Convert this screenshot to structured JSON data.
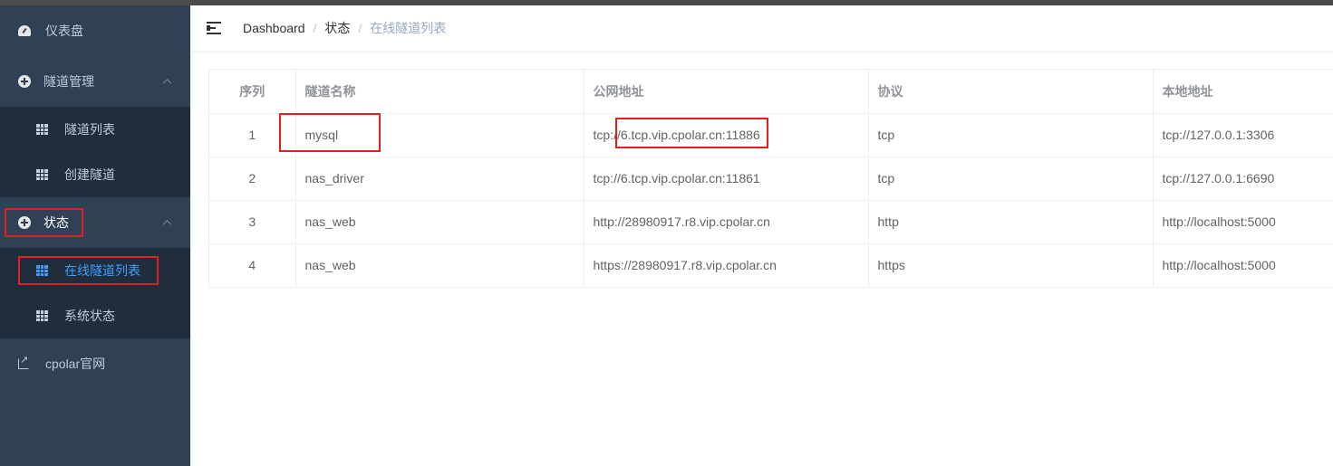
{
  "sidebar": {
    "dashboard": "仪表盘",
    "tunnel_manage": "隧道管理",
    "tunnel_list": "隧道列表",
    "create_tunnel": "创建隧道",
    "status": "状态",
    "online_tunnel_list": "在线隧道列表",
    "system_status": "系统状态",
    "cpolar_site": "cpolar官网"
  },
  "breadcrumb": {
    "root": "Dashboard",
    "sep1": "/",
    "mid": "状态",
    "sep2": "/",
    "current": "在线隧道列表"
  },
  "table": {
    "headers": [
      "序列",
      "隧道名称",
      "公网地址",
      "协议",
      "本地地址"
    ],
    "rows": [
      [
        "1",
        "mysql",
        "tcp://6.tcp.vip.cpolar.cn:11886",
        "tcp",
        "tcp://127.0.0.1:3306"
      ],
      [
        "2",
        "nas_driver",
        "tcp://6.tcp.vip.cpolar.cn:11861",
        "tcp",
        "tcp://127.0.0.1:6690"
      ],
      [
        "3",
        "nas_web",
        "http://28980917.r8.vip.cpolar.cn",
        "http",
        "http://localhost:5000"
      ],
      [
        "4",
        "nas_web",
        "https://28980917.r8.vip.cpolar.cn",
        "https",
        "http://localhost:5000"
      ]
    ]
  },
  "colors": {
    "sidebar_bg": "#304156",
    "submenu_bg": "#1f2d3d",
    "active": "#409eff",
    "highlight_box": "#e02020"
  }
}
